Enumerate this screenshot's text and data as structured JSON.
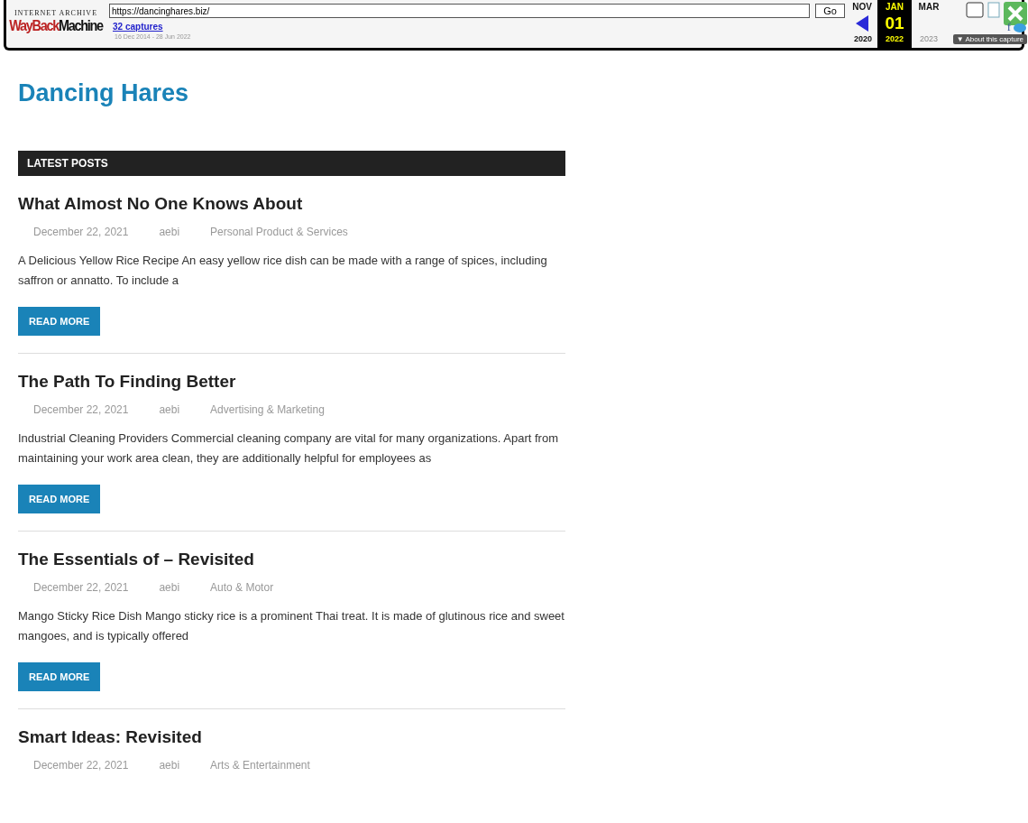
{
  "wayback_toolbar": {
    "logo_top": "INTERNET ARCHIVE",
    "logo_wayback": "WayBack",
    "logo_machine": "Machine",
    "url": "https://dancinghares.biz/",
    "go_button": "Go",
    "captures_link": "32 captures",
    "capture_range": "16 Dec 2014 - 28 Jun 2022",
    "calendar": [
      {
        "month": "NOV",
        "year": "2020",
        "selected": false,
        "available": true
      },
      {
        "month": "JAN",
        "day": "01",
        "year": "2022",
        "selected": true,
        "available": true
      },
      {
        "month": "MAR",
        "year": "2023",
        "selected": false,
        "available": false
      }
    ],
    "about_button": "▼ About this capture",
    "facebook_glyph": "f"
  },
  "site_title": "Dancing Hares",
  "section_heading": "LATEST POSTS",
  "posts": [
    {
      "title": "What Almost No One Knows About",
      "date": "December 22, 2021",
      "author": "aebi",
      "category": "Personal Product & Services",
      "excerpt": "A Delicious Yellow Rice Recipe An easy yellow rice dish can be made with a range of spices, including saffron or annatto. To include a",
      "button": "READ MORE"
    },
    {
      "title": "The Path To Finding Better",
      "date": "December 22, 2021",
      "author": "aebi",
      "category": "Advertising & Marketing",
      "excerpt": "Industrial Cleaning Providers Commercial cleaning company are vital for many organizations. Apart from maintaining your work area clean, they are additionally helpful for employees as",
      "button": "READ MORE"
    },
    {
      "title": "The Essentials of – Revisited",
      "date": "December 22, 2021",
      "author": "aebi",
      "category": "Auto & Motor",
      "excerpt": "Mango Sticky Rice Dish Mango sticky rice is a prominent Thai treat. It is made of glutinous rice and sweet mangoes, and is typically offered",
      "button": "READ MORE"
    },
    {
      "title": "Smart Ideas: Revisited",
      "date": "December 22, 2021",
      "author": "aebi",
      "category": "Arts & Entertainment"
    }
  ]
}
